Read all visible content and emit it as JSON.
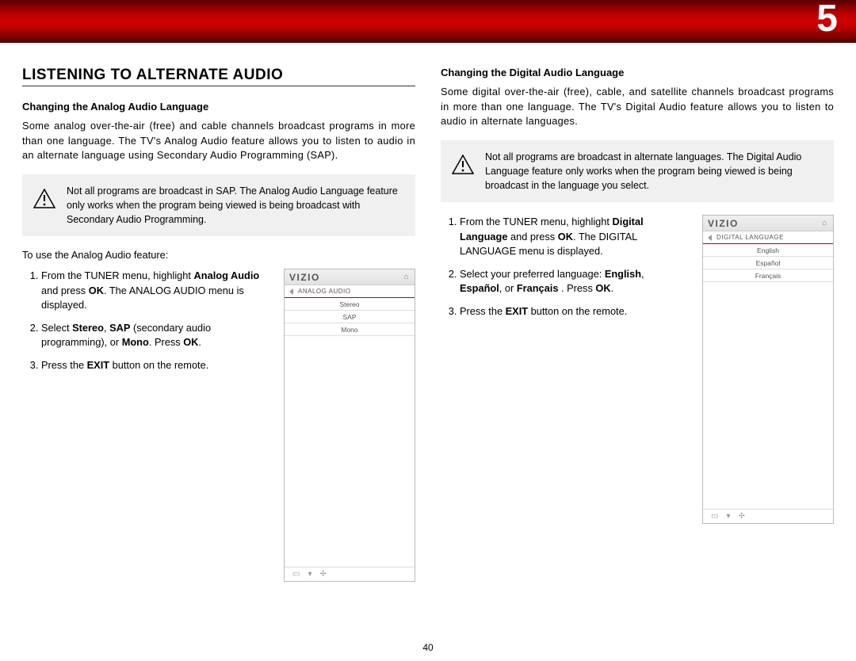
{
  "chapter": "5",
  "pageNumber": "40",
  "left": {
    "sectionTitle": "LISTENING TO ALTERNATE AUDIO",
    "sub": "Changing the Analog Audio Language",
    "intro": "Some analog over-the-air (free) and cable channels broadcast programs in more than one language. The TV's Analog Audio feature allows you to listen to audio in an alternate language using Secondary Audio Programming (SAP).",
    "note": "Not all programs are broadcast in SAP. The Analog Audio Language feature only works when the program being viewed is being broadcast with Secondary Audio Programming.",
    "lead": "To use the Analog Audio feature:",
    "step1_a": "From the TUNER menu, highlight ",
    "step1_b": "Analog Audio",
    "step1_c": " and press ",
    "step1_d": "OK",
    "step1_e": ". The ANALOG AUDIO menu is displayed.",
    "step2_a": "Select ",
    "step2_b": "Stereo",
    "step2_c": ", ",
    "step2_d": "SAP",
    "step2_e": " (secondary audio programming), or ",
    "step2_f": "Mono",
    "step2_g": ". Press ",
    "step2_h": "OK",
    "step2_i": ".",
    "step3_a": "Press the ",
    "step3_b": "EXIT",
    "step3_c": " button on the remote.",
    "menu": {
      "brand": "VIZIO",
      "title": "ANALOG AUDIO",
      "items": [
        "Stereo",
        "SAP",
        "Mono"
      ]
    }
  },
  "right": {
    "sub": "Changing the Digital Audio Language",
    "intro": "Some digital over-the-air (free), cable, and satellite channels broadcast programs in more than one language. The TV's Digital Audio feature allows you to listen to audio in alternate languages.",
    "note": "Not all programs are broadcast in alternate languages. The Digital Audio Language feature only works when the program being viewed is being broadcast in the language you select.",
    "step1_a": "From the TUNER menu, highlight ",
    "step1_b": "Digital Language",
    "step1_c": " and press ",
    "step1_d": "OK",
    "step1_e": ". The DIGITAL LANGUAGE menu is displayed.",
    "step2_a": "Select your preferred language: ",
    "step2_b": "English",
    "step2_c": ", ",
    "step2_d": "Español",
    "step2_e": ",  or ",
    "step2_f": "Français",
    "step2_g": " . Press ",
    "step2_h": "OK",
    "step2_i": ".",
    "step3_a": "Press the ",
    "step3_b": "EXIT",
    "step3_c": " button on the remote.",
    "menu": {
      "brand": "VIZIO",
      "title": "DIGITAL LANGUAGE",
      "items": [
        "English",
        "Español",
        "Français"
      ]
    }
  }
}
